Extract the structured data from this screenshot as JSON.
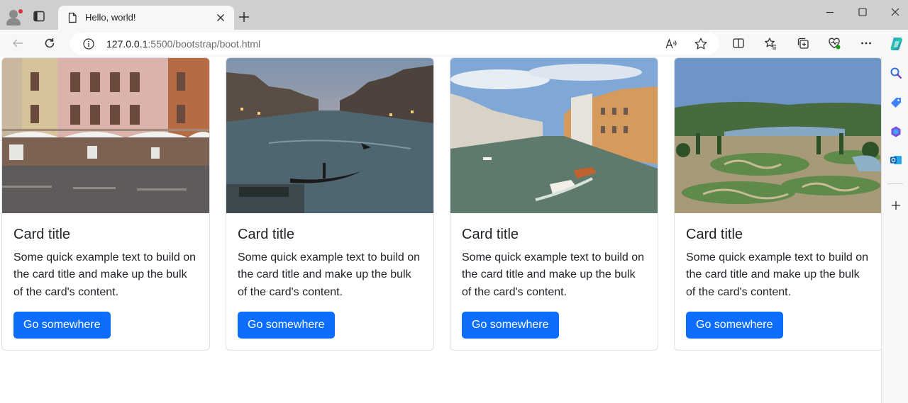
{
  "browser": {
    "tab": {
      "title": "Hello, world!"
    },
    "address": {
      "host": "127.0.0.1",
      "path": ":5500/bootstrap/boot.html"
    },
    "icons": {
      "profile": "profile-avatar-icon",
      "tab_actions": "tab-actions-icon",
      "favicon": "page-icon",
      "close": "close-icon",
      "new_tab": "plus-icon",
      "back": "arrow-left-icon",
      "refresh": "refresh-icon",
      "info": "info-icon",
      "read_aloud": "read-aloud-icon",
      "favorite": "star-icon",
      "split": "split-screen-icon",
      "favorites": "favorites-icon",
      "collections": "collections-icon",
      "health": "browser-essentials-icon",
      "menu": "more-icon",
      "copilot": "copilot-icon"
    },
    "accent": "#0d6efd"
  },
  "cards": [
    {
      "title": "Card title",
      "text": "Some quick example text to build on the card title and make up the bulk of the card's content.",
      "button": "Go somewhere",
      "image_subject": "street cafe in front of pink building"
    },
    {
      "title": "Card title",
      "text": "Some quick example text to build on the card title and make up the bulk of the card's content.",
      "button": "Go somewhere",
      "image_subject": "venice grand canal at dusk with gondola"
    },
    {
      "title": "Card title",
      "text": "Some quick example text to build on the card title and make up the bulk of the card's content.",
      "button": "Go somewhere",
      "image_subject": "venice grand canal by day with boats"
    },
    {
      "title": "Card title",
      "text": "Some quick example text to build on the card title and make up the bulk of the card's content.",
      "button": "Go somewhere",
      "image_subject": "formal garden with lake"
    }
  ]
}
